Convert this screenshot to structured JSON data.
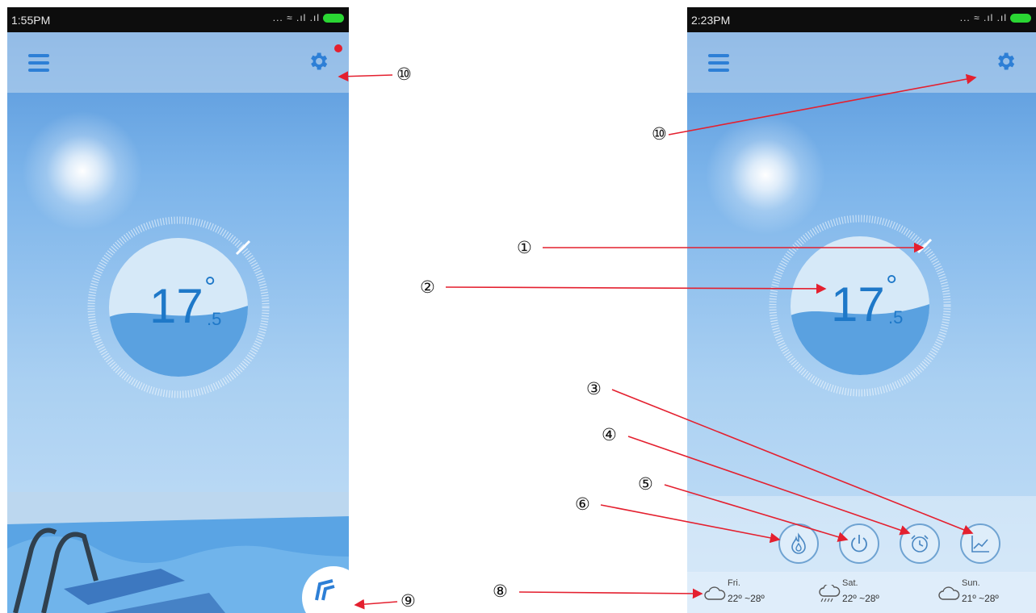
{
  "left_screen": {
    "status_time": "1:55PM",
    "status_icons": "... ≈ .ıl .ıl",
    "temp_integer": "17",
    "temp_degree": "°",
    "temp_fraction": ".5"
  },
  "right_screen": {
    "status_time": "2:23PM",
    "status_icons": "... ≈ .ıl .ıl",
    "temp_integer": "17",
    "temp_degree": "°",
    "temp_fraction": ".5",
    "forecast": [
      {
        "day": "Fri.",
        "range": "22º ~28º",
        "icon": "cloud-icon"
      },
      {
        "day": "Sat.",
        "range": "22º ~28º",
        "icon": "cloud-rain-icon"
      },
      {
        "day": "Sun.",
        "range": "21º ~28º",
        "icon": "cloud-icon"
      }
    ],
    "controls": [
      "heat-mode-button",
      "power-button",
      "timer-button",
      "chart-button"
    ]
  },
  "callouts": {
    "c1": "①",
    "c2": "②",
    "c3": "③",
    "c4": "④",
    "c5": "⑤",
    "c6": "⑥",
    "c8": "⑧",
    "c9": "⑨",
    "c10a": "⑩",
    "c10b": "⑩"
  },
  "colors": {
    "accent": "#2d7fd6",
    "arrow": "#e4202f",
    "battery": "#2ad633"
  }
}
